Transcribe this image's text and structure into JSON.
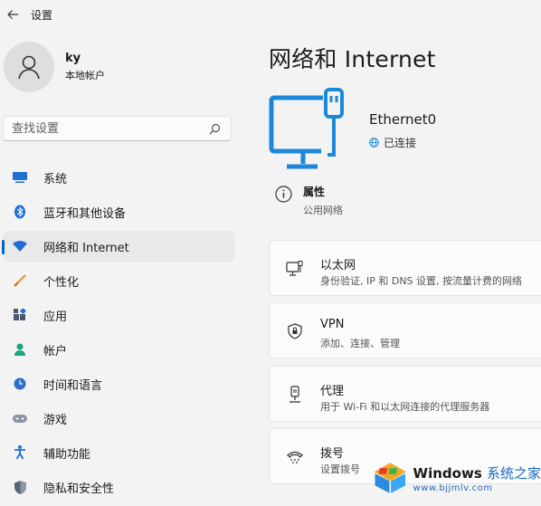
{
  "titlebar": {
    "title": "设置"
  },
  "user": {
    "name": "ky",
    "type": "本地帐户"
  },
  "search": {
    "placeholder": "查找设置"
  },
  "nav": [
    {
      "label": "系统",
      "icon": "monitor-icon"
    },
    {
      "label": "蓝牙和其他设备",
      "icon": "bluetooth-icon"
    },
    {
      "label": "网络和 Internet",
      "icon": "wifi-icon",
      "selected": true
    },
    {
      "label": "个性化",
      "icon": "brush-icon"
    },
    {
      "label": "应用",
      "icon": "apps-icon"
    },
    {
      "label": "帐户",
      "icon": "person-icon"
    },
    {
      "label": "时间和语言",
      "icon": "globe-clock-icon"
    },
    {
      "label": "游戏",
      "icon": "gamepad-icon"
    },
    {
      "label": "辅助功能",
      "icon": "accessibility-icon"
    },
    {
      "label": "隐私和安全性",
      "icon": "shield-icon"
    }
  ],
  "main": {
    "title": "网络和 Internet",
    "device": {
      "name": "Ethernet0",
      "status": "已连接"
    },
    "properties": {
      "title": "属性",
      "subtitle": "公用网络"
    },
    "cards": [
      {
        "title": "以太网",
        "subtitle": "身份验证, IP 和 DNS 设置, 按流量计费的网络",
        "icon": "ethernet-icon"
      },
      {
        "title": "VPN",
        "subtitle": "添加、连接、管理",
        "icon": "vpn-shield-icon"
      },
      {
        "title": "代理",
        "subtitle": "用于 Wi-Fi 和以太网连接的代理服务器",
        "icon": "proxy-icon"
      },
      {
        "title": "拨号",
        "subtitle": "设置拨号",
        "icon": "dialup-icon"
      }
    ]
  },
  "watermark": {
    "line1_en": "Windows",
    "line1_cn": "系统之家",
    "line2": "www.bjjmlv.com"
  },
  "colors": {
    "accent": "#0067c0",
    "icon_blue": "#1e88d8",
    "background": "#f3f3f3"
  }
}
